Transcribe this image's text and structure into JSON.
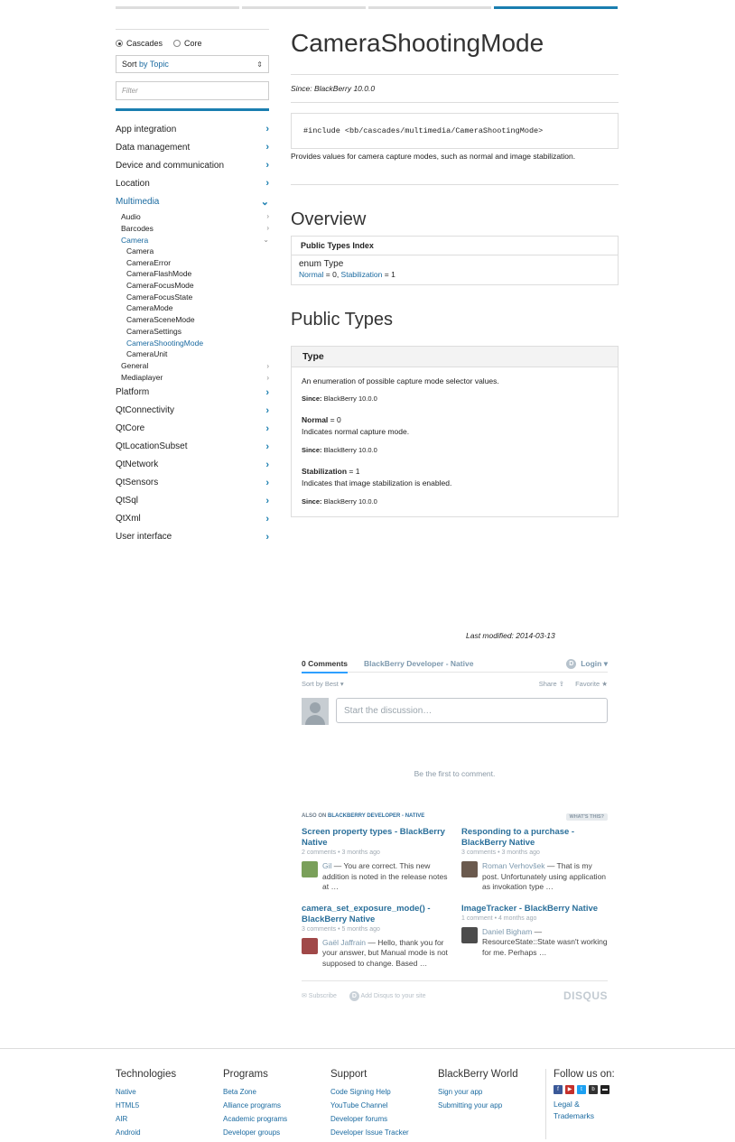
{
  "sidebar": {
    "radio_cascades": "Cascades",
    "radio_core": "Core",
    "sort_prefix": "Sort",
    "sort_by": "by Topic",
    "filter_placeholder": "Filter",
    "items": [
      {
        "label": "App integration"
      },
      {
        "label": "Data management"
      },
      {
        "label": "Device and communication"
      },
      {
        "label": "Location"
      },
      {
        "label": "Multimedia"
      },
      {
        "label": "Platform"
      },
      {
        "label": "QtConnectivity"
      },
      {
        "label": "QtCore"
      },
      {
        "label": "QtLocationSubset"
      },
      {
        "label": "QtNetwork"
      },
      {
        "label": "QtSensors"
      },
      {
        "label": "QtSql"
      },
      {
        "label": "QtXml"
      },
      {
        "label": "User interface"
      }
    ],
    "multimedia_subs": [
      "Audio",
      "Barcodes",
      "Camera",
      "General",
      "Mediaplayer"
    ],
    "camera_leaves": [
      "Camera",
      "CameraError",
      "CameraFlashMode",
      "CameraFocusMode",
      "CameraFocusState",
      "CameraMode",
      "CameraSceneMode",
      "CameraSettings",
      "CameraShootingMode",
      "CameraUnit"
    ]
  },
  "main": {
    "title": "CameraShootingMode",
    "since": "Since: BlackBerry 10.0.0",
    "include": "#include <bb/cascades/multimedia/CameraShootingMode>",
    "description": "Provides values for camera capture modes, such as normal and image stabilization.",
    "overview_title": "Overview",
    "pti_head": "Public Types Index",
    "pti_enum": "enum Type",
    "pti_normal": "Normal",
    "pti_normal_val": " = 0, ",
    "pti_stab": "Stabilization",
    "pti_stab_val": " = 1",
    "public_types_title": "Public Types",
    "type_head": "Type",
    "type_desc": "An enumeration of possible capture mode selector values.",
    "since_label": "Since:",
    "since_value": " BlackBerry 10.0.0",
    "normal_name": "Normal",
    "normal_val": " = 0",
    "normal_desc": "Indicates normal capture mode.",
    "stab_name": "Stabilization",
    "stab_val": " = 1",
    "stab_desc": "Indicates that image stabilization is enabled.",
    "last_modified": "Last modified: 2014-03-13"
  },
  "disqus": {
    "comments_tab": "0 Comments",
    "community_tab": "BlackBerry Developer - Native",
    "login": "Login ▾",
    "sort": "Sort by Best ▾",
    "share": "Share ⇪",
    "favorite": "Favorite ★",
    "input_placeholder": "Start the discussion…",
    "first_comment": "Be the first to comment.",
    "also_on_prefix": "ALSO ON ",
    "also_on_brand": "BLACKBERRY DEVELOPER - NATIVE",
    "whats_this": "WHAT'S THIS?",
    "recs": [
      {
        "title": "Screen property types - BlackBerry Native",
        "meta": "2 comments • 3 months ago",
        "who": "Gil",
        "text": " — You are correct. This new addition is noted in the release notes at …",
        "color": "#7aa05a"
      },
      {
        "title": "Responding to a purchase - BlackBerry Native",
        "meta": "3 comments • 3 months ago",
        "who": "Roman Verhovšek",
        "text": " — That is my post. Unfortunately using application as invokation type …",
        "color": "#6b5a4e"
      },
      {
        "title": "camera_set_exposure_mode() - BlackBerry Native",
        "meta": "3 comments • 5 months ago",
        "who": "Gaël Jaffrain",
        "text": " — Hello, thank you for your answer, but Manual mode is not supposed to change. Based …",
        "color": "#a04848"
      },
      {
        "title": "ImageTracker - BlackBerry Native",
        "meta": "1 comment • 4 months ago",
        "who": "Daniel Bigham",
        "text": " — ResourceState::State wasn't working for me. Perhaps …",
        "color": "#4c4c4c"
      }
    ],
    "subscribe": "✉ Subscribe",
    "add_disqus": "Add Disqus to your site",
    "brand": "DISQUS"
  },
  "footer": {
    "cols": [
      {
        "title": "Technologies",
        "links": [
          "Native",
          "HTML5",
          "AIR",
          "Android"
        ]
      },
      {
        "title": "Programs",
        "links": [
          "Beta Zone",
          "Alliance programs",
          "Academic programs",
          "Developer groups"
        ]
      },
      {
        "title": "Support",
        "links": [
          "Code Signing Help",
          "YouTube Channel",
          "Developer forums",
          "Developer Issue Tracker"
        ]
      },
      {
        "title": "BlackBerry World",
        "links": [
          "Sign your app",
          "Submitting your app"
        ]
      }
    ],
    "follow_title": "Follow us on:",
    "legal": "Legal & Trademarks"
  }
}
